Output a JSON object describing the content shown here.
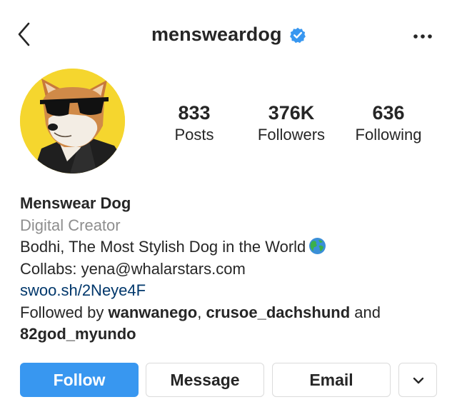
{
  "header": {
    "back_icon": "chevron-left-icon",
    "username": "mensweardog",
    "verified_icon": "verified-badge-icon",
    "verified_color": "#3897f0",
    "more_icon": "more-options-icon"
  },
  "profile": {
    "avatar_icon": "profile-avatar-dog-with-sunglasses",
    "avatar_background": "#f5d62e",
    "stats": {
      "posts": {
        "count": "833",
        "label": "Posts"
      },
      "followers": {
        "count": "376K",
        "label": "Followers"
      },
      "following": {
        "count": "636",
        "label": "Following"
      }
    }
  },
  "bio": {
    "name": "Menswear Dog",
    "category": "Digital Creator",
    "description": "Bodhi, The Most Stylish Dog in the World",
    "globe_icon": "globe-emoji-icon",
    "collabs": "Collabs: yena@whalarstars.com",
    "link": "swoo.sh/2Neye4F",
    "followed_by": {
      "prefix": "Followed by ",
      "user1": "wanwanego",
      "separator": ", ",
      "user2": "crusoe_dachshund",
      "conjunction": " and",
      "user3": "82god_myundo"
    }
  },
  "actions": {
    "follow_label": "Follow",
    "message_label": "Message",
    "email_label": "Email",
    "dropdown_icon": "chevron-down-icon",
    "follow_color": "#3897f0"
  }
}
